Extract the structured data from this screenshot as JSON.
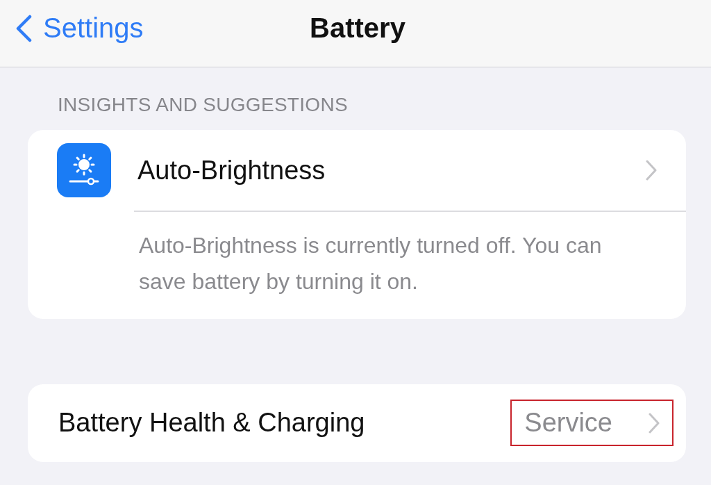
{
  "nav": {
    "back_label": "Settings",
    "title": "Battery"
  },
  "sections": [
    {
      "header": "INSIGHTS AND SUGGESTIONS",
      "rows": [
        {
          "kind": "icon",
          "label": "Auto-Brightness"
        }
      ],
      "footer": "Auto-Brightness is currently turned off. You can save battery by turning it on."
    },
    {
      "rows": [
        {
          "kind": "value",
          "label": "Battery Health & Charging",
          "value": "Service",
          "highlighted": true
        }
      ]
    }
  ]
}
